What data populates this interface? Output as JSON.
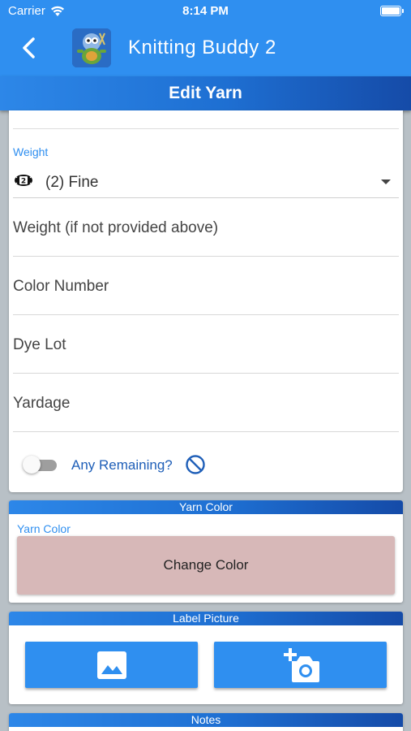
{
  "status_bar": {
    "carrier": "Carrier",
    "time": "8:14 PM"
  },
  "app_bar": {
    "title": "Knitting Buddy 2",
    "back_icon": "chevron-left-icon",
    "app_icon": "knitting-buddy-logo"
  },
  "page_title": "Edit Yarn",
  "form": {
    "weight_label": "Weight",
    "weight_value": "(2) Fine",
    "weight_icon": "yarn-weight-2-icon",
    "weight_alt_placeholder": "Weight (if not provided above)",
    "color_number_placeholder": "Color Number",
    "dye_lot_placeholder": "Dye Lot",
    "yardage_placeholder": "Yardage",
    "any_remaining_label": "Any Remaining?",
    "any_remaining_on": false
  },
  "yarn_color": {
    "header": "Yarn Color",
    "label": "Yarn Color",
    "swatch": "#d7b8b8",
    "button_label": "Change Color"
  },
  "label_picture": {
    "header": "Label Picture",
    "gallery_icon": "image-icon",
    "camera_icon": "add-a-photo-icon"
  },
  "notes": {
    "header": "Notes"
  },
  "colors": {
    "primary": "#2f8ff0",
    "header_dark": "#154ba8",
    "link": "#1f5fb8"
  }
}
